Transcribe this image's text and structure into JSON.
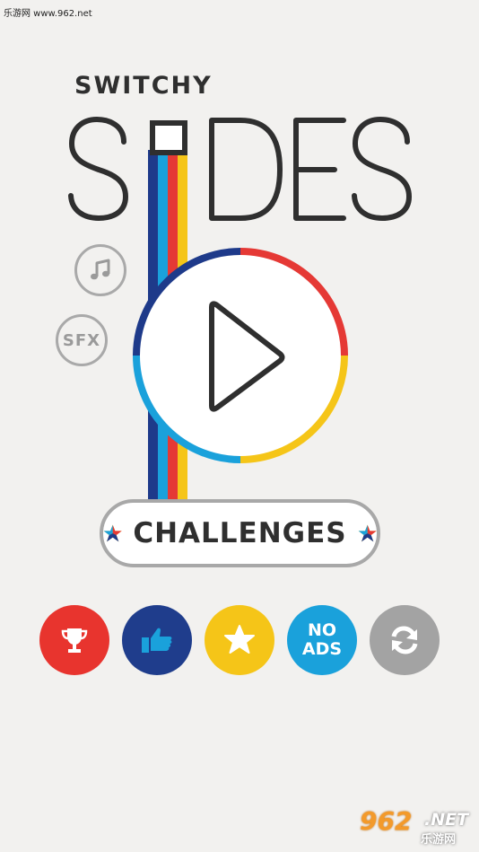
{
  "watermark": {
    "top_text": "乐游网 www.962.net",
    "logo_big": "962",
    "logo_net": ".NET",
    "logo_cn": "乐游网"
  },
  "title": {
    "small": "SWITCHY",
    "large_letters": [
      "S",
      "D",
      "E",
      "S"
    ]
  },
  "sound": {
    "music_icon": "music-note-icon",
    "sfx_label": "SFX"
  },
  "play": {
    "icon": "play-triangle-icon"
  },
  "challenges": {
    "label": "CHALLENGES",
    "icon": "tricolor-star-icon"
  },
  "actions": [
    {
      "name": "leaderboard",
      "icon": "trophy-icon",
      "color": "#e8342e"
    },
    {
      "name": "like",
      "icon": "thumbs-up-icon",
      "color": "#1f3d8c"
    },
    {
      "name": "rate",
      "icon": "star-icon",
      "color": "#f5c518"
    },
    {
      "name": "no-ads",
      "label": "NO\nADS",
      "label_line1": "NO",
      "label_line2": "ADS",
      "color": "#1aa1db"
    },
    {
      "name": "restore",
      "icon": "refresh-icon",
      "color": "#a3a3a3"
    }
  ],
  "colors": {
    "background": "#f2f1ef",
    "navy": "#1e3a8a",
    "sky": "#1aa1db",
    "red": "#e53935",
    "yellow": "#f5c518",
    "ink": "#2f2f2f",
    "gray": "#a8a8a8"
  }
}
